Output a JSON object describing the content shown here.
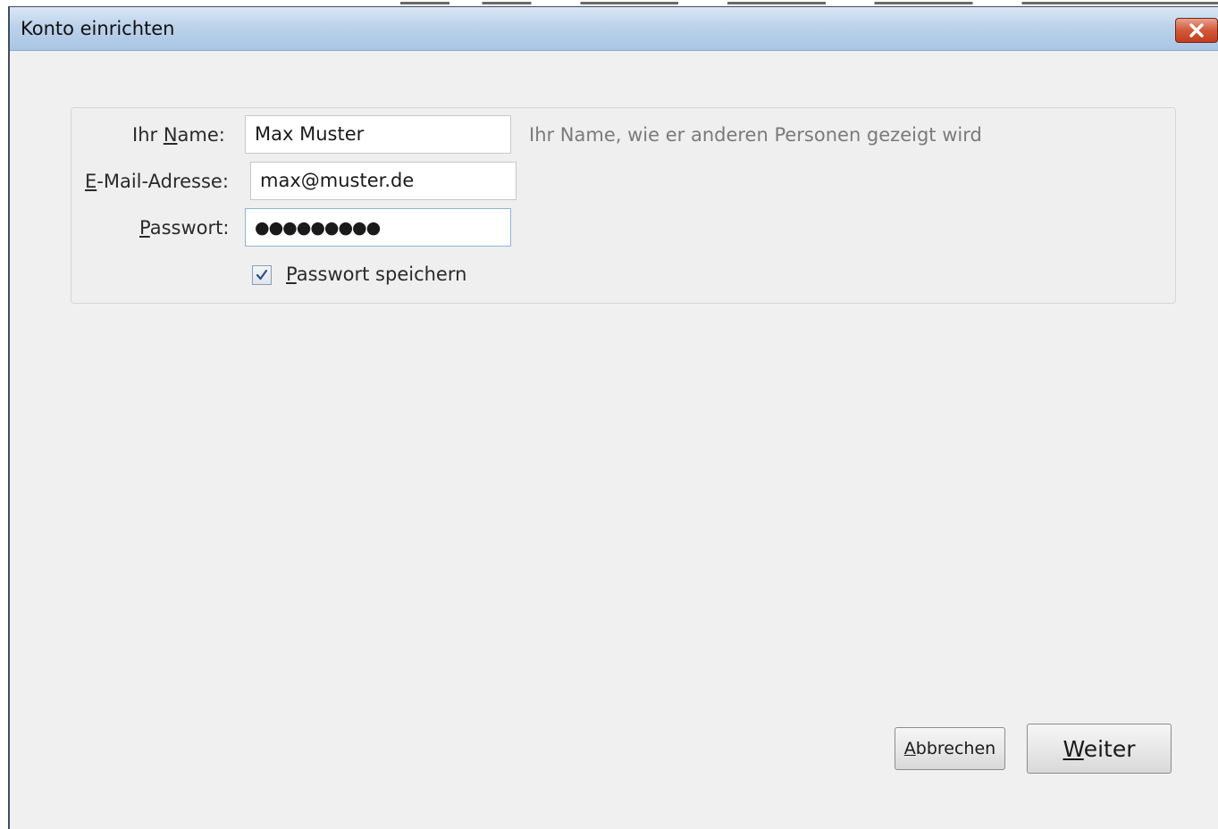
{
  "window": {
    "title": "Konto einrichten"
  },
  "form": {
    "name": {
      "label_prefix": "Ihr ",
      "label_key": "N",
      "label_suffix": "ame:",
      "value": "Max Muster",
      "hint": "Ihr Name, wie er anderen Personen gezeigt wird"
    },
    "email": {
      "label_key": "E",
      "label_suffix": "-Mail-Adresse:",
      "value": "max@muster.de"
    },
    "password": {
      "label_key": "P",
      "label_suffix": "asswort:",
      "value": "●●●●●●●●●"
    },
    "remember": {
      "label_key": "P",
      "label_suffix": "asswort speichern",
      "checked": true
    }
  },
  "buttons": {
    "cancel_key": "A",
    "cancel_suffix": "bbrechen",
    "next_key": "W",
    "next_suffix": "eiter"
  },
  "icons": {
    "close": "close-icon",
    "check": "checkmark-icon"
  },
  "colors": {
    "titlebar": "#bcd2ea",
    "close_button": "#d2583a",
    "background": "#f0f0f0"
  }
}
